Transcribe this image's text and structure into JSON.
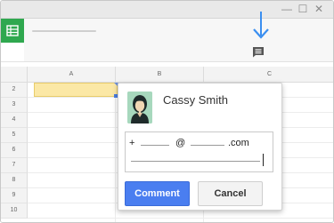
{
  "window": {
    "controls": [
      "minimize-icon",
      "maximize-icon",
      "close-icon"
    ],
    "minimize_glyph": "—",
    "maximize_glyph": "☐",
    "close_glyph": "✕"
  },
  "grid": {
    "columns": [
      "A",
      "B",
      "C"
    ],
    "rows": [
      "2",
      "3",
      "4",
      "5",
      "6",
      "7",
      "8",
      "9",
      "10"
    ],
    "highlight_color": "#fbe8a6",
    "selection_color": "#4a7de0"
  },
  "comment": {
    "user_name": "Cassy Smith",
    "draft_prefix": "+",
    "draft_at": "@",
    "draft_suffix": ".com",
    "comment_label": "Comment",
    "cancel_label": "Cancel",
    "comment_button_color": "#4a7ef0"
  },
  "icons": {
    "arrow": "down-arrow-icon",
    "comment": "comment-icon",
    "app": "sheets-logo-icon"
  },
  "colors": {
    "arrow": "#3b8ff0",
    "sheets_green": "#2fa84f"
  }
}
